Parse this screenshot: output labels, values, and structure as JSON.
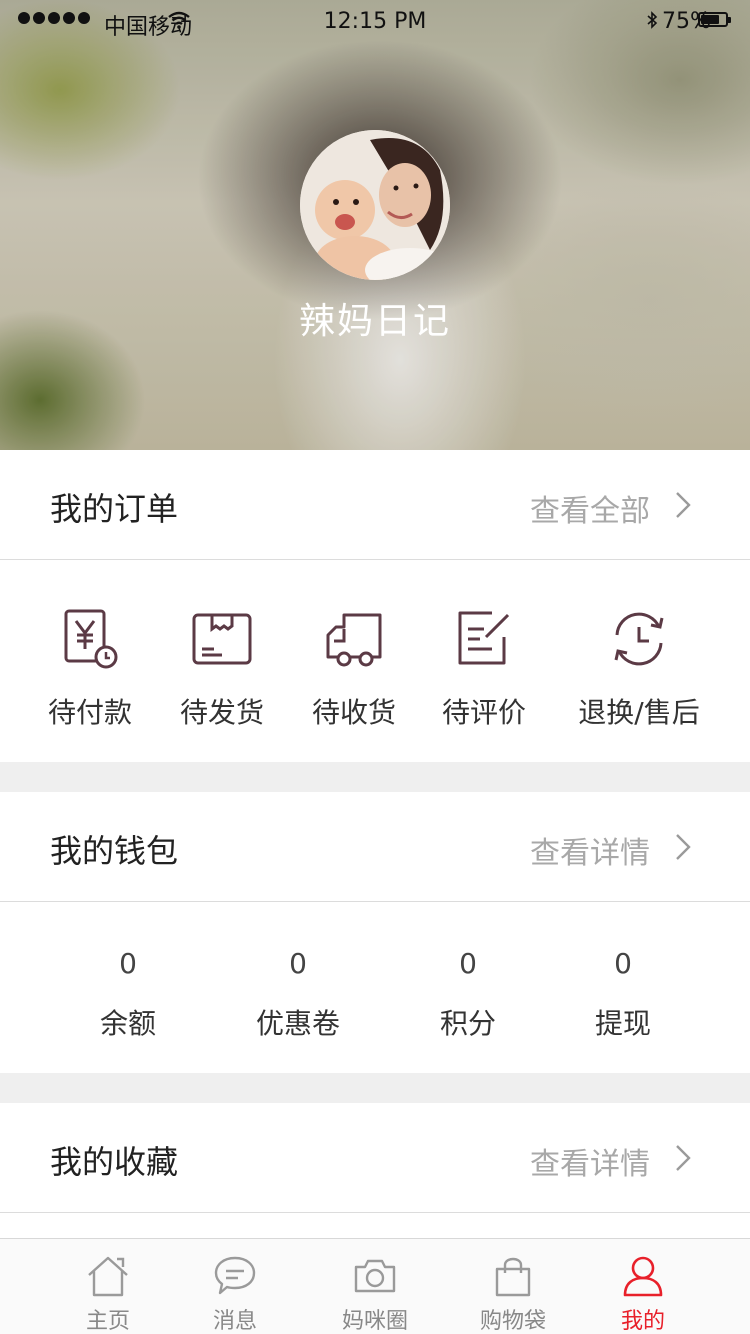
{
  "status_bar": {
    "carrier": "中国移动",
    "time": "12:15 PM",
    "battery": "75%",
    "battery_level": 0.75
  },
  "profile": {
    "username": "辣妈日记"
  },
  "orders": {
    "title": "我的订单",
    "link": "查看全部",
    "items": [
      {
        "label": "待付款",
        "icon": "payment-pending-icon"
      },
      {
        "label": "待发货",
        "icon": "box-icon"
      },
      {
        "label": "待收货",
        "icon": "truck-icon"
      },
      {
        "label": "待评价",
        "icon": "review-icon"
      },
      {
        "label": "退换/售后",
        "icon": "refund-icon"
      }
    ]
  },
  "wallet": {
    "title": "我的钱包",
    "link": "查看详情",
    "items": [
      {
        "value": "0",
        "label": "余额"
      },
      {
        "value": "0",
        "label": "优惠卷"
      },
      {
        "value": "0",
        "label": "积分"
      },
      {
        "value": "0",
        "label": "提现"
      }
    ]
  },
  "favorites": {
    "title": "我的收藏",
    "link": "查看详情"
  },
  "tabbar": {
    "items": [
      {
        "label": "主页",
        "icon": "home-icon"
      },
      {
        "label": "消息",
        "icon": "message-icon"
      },
      {
        "label": "妈咪圈",
        "icon": "camera-icon"
      },
      {
        "label": "购物袋",
        "icon": "bag-icon"
      },
      {
        "label": "我的",
        "icon": "user-icon",
        "active": true
      }
    ]
  },
  "colors": {
    "icon": "#5b3a45",
    "accent": "#e8202a",
    "muted": "#a8a8a8"
  }
}
